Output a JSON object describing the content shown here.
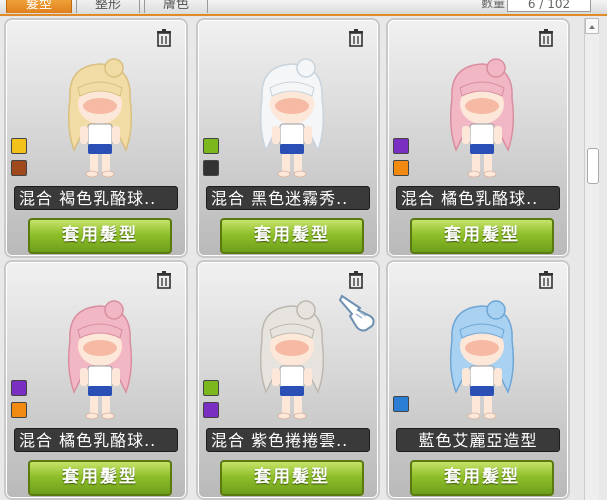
{
  "tabs": [
    {
      "label": "髮型",
      "active": true
    },
    {
      "label": "整形",
      "active": false
    },
    {
      "label": "膚色",
      "active": false
    }
  ],
  "counter": {
    "label": "數量",
    "value": "6 / 102"
  },
  "apply_label": "套用髮型",
  "cards": [
    {
      "name": "混合 褐色乳酪球..",
      "hair": "#f1dca6",
      "hair_shade": "#d9bf80",
      "swatches": [
        "#f2c21b",
        "#a0491d"
      ]
    },
    {
      "name": "混合 黑色迷霧秀..",
      "hair": "#f4f6f8",
      "hair_shade": "#c9d3dc",
      "swatches": [
        "#7bb81e",
        "#333333"
      ]
    },
    {
      "name": "混合 橘色乳酪球..",
      "hair": "#f2b7c4",
      "hair_shade": "#d98ea0",
      "swatches": [
        "#7a2fc2",
        "#f08a10"
      ]
    },
    {
      "name": "混合 橘色乳酪球..",
      "hair": "#f2b7c4",
      "hair_shade": "#d98ea0",
      "swatches": [
        "#7a2fc2",
        "#f08a10"
      ]
    },
    {
      "name": "混合 紫色捲捲雲..",
      "hair": "#e7e4df",
      "hair_shade": "#bdb8af",
      "swatches": [
        "#7bb81e",
        "#7a2fc2"
      ]
    },
    {
      "name": "藍色艾麗亞造型",
      "hair": "#a9d2f2",
      "hair_shade": "#6fa6d6",
      "swatches": [
        "#2a7fd4"
      ]
    }
  ]
}
